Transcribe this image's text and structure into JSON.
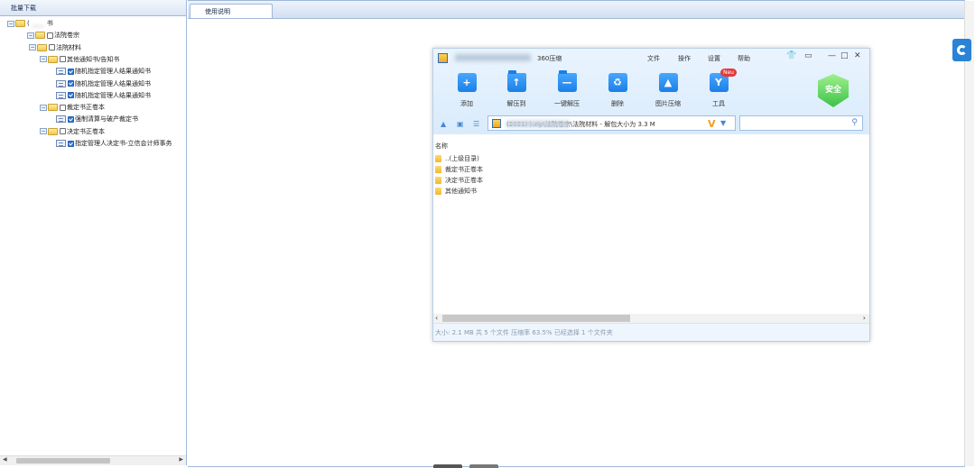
{
  "left_panel": {
    "header": "批量下载",
    "tree": [
      {
        "level": 0,
        "label": "(",
        "label_blurred": "____",
        "suffix": "书",
        "checkbox": false,
        "icon": "folder-icon"
      },
      {
        "level": 1,
        "label": "法院卷宗",
        "checkbox": "off",
        "icon": "folder-icon"
      },
      {
        "level": 2,
        "label": "法院材料",
        "checkbox": "off",
        "icon": "folder-icon"
      },
      {
        "level": 3,
        "label": "其他通知书/告知书",
        "checkbox": "off",
        "icon": "folder-icon"
      },
      {
        "level": 4,
        "label": "随机指定管理人结果通知书",
        "checkbox": "on",
        "icon": "file-icon"
      },
      {
        "level": 4,
        "label": "随机指定管理人结果通知书",
        "checkbox": "on",
        "icon": "file-icon"
      },
      {
        "level": 4,
        "label": "随机指定管理人结果通知书",
        "checkbox": "on",
        "icon": "file-icon"
      },
      {
        "level": 3,
        "label": "裁定书正卷本",
        "checkbox": "off",
        "icon": "folder-icon"
      },
      {
        "level": 4,
        "label": "强制清算与破产裁定书",
        "checkbox": "on",
        "icon": "file-icon"
      },
      {
        "level": 3,
        "label": "决定书正卷本",
        "checkbox": "off",
        "icon": "folder-icon"
      },
      {
        "level": 4,
        "label": "指定管理人决定书-立信会计师事务",
        "checkbox": "on",
        "icon": "file-icon"
      }
    ]
  },
  "right_panel": {
    "tab_label": "使用说明"
  },
  "archive_window": {
    "app_name": "360压缩",
    "menu": [
      "文件",
      "操作",
      "设置",
      "帮助"
    ],
    "controls": {
      "skin": "👕",
      "msg": "▭",
      "min": "—",
      "max": "□",
      "close": "✕"
    },
    "toolbar": [
      {
        "label": "添加",
        "icon": "add-icon",
        "glyph": "+"
      },
      {
        "label": "解压到",
        "icon": "extract-to-icon",
        "glyph": "↑"
      },
      {
        "label": "一键解压",
        "icon": "one-click-extract-icon",
        "glyph": "—"
      },
      {
        "label": "删除",
        "icon": "delete-icon",
        "glyph": "♻"
      },
      {
        "label": "图片压缩",
        "icon": "image-compress-icon",
        "glyph": "▲"
      },
      {
        "label": "工具",
        "icon": "tools-icon",
        "glyph": "Y"
      }
    ],
    "tools_badge": "Neu",
    "safe_label": "安全",
    "path_text": "(2021)          ).zip\\法院卷宗\\法院材料 - 解包大小为 3.3 M",
    "path_suffix_icon": "V",
    "column_header": "名称",
    "files": [
      "..(上级目录)",
      "裁定书正卷本",
      "决定书正卷本",
      "其他通知书"
    ],
    "status": "大小: 2.1 MB 共 5 个文件 压缩率 63.5% 已经选择 1 个文件夹"
  },
  "colors": {
    "accent": "#1b7fe6",
    "safe_green": "#3cc247",
    "badge_red": "#e23b3b"
  }
}
